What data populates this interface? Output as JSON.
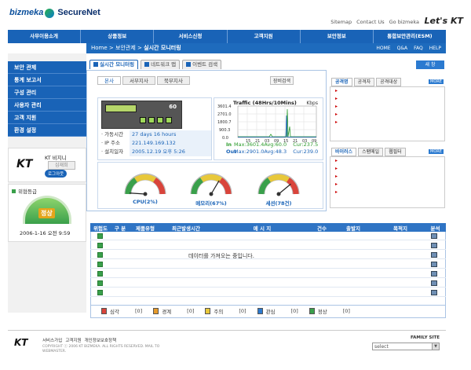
{
  "brand": {
    "name1": "bizmeka",
    "name2": "SecureNet",
    "tagline": "Let's KT"
  },
  "top_links": [
    "Sitemap",
    "Contact Us",
    "Go bizmeka"
  ],
  "gnb": [
    "사무이용소개",
    "상품정보",
    "서비스신청",
    "고객지원",
    "보안정보",
    "통합보안관리(ESM)"
  ],
  "breadcrumb": {
    "home": "Home",
    "sep": ">",
    "section": "보안관제",
    "current": "실시간 모니터링"
  },
  "util_links": [
    "HOME",
    "Q&A",
    "FAQ",
    "HELP"
  ],
  "lnb": [
    "보안 관제",
    "통계 보고서",
    "구성 관리",
    "사용자 관리",
    "고객 지원",
    "환경 설정"
  ],
  "kt_user": {
    "logo": "KT",
    "name": "KT 비지니",
    "sub": "심재희",
    "btn": "로그아웃"
  },
  "risk": {
    "title": "위협등급",
    "level": "정상",
    "datetime": "2006-1-16 오전 9:59"
  },
  "main_tabs": [
    "실시간 모니터링",
    "네트워크 맵",
    "이벤트 검색"
  ],
  "new_btn": "새 창",
  "branch_tabs": [
    "본사",
    "서부지사",
    "북부지사"
  ],
  "equip_search": "장비검색",
  "device": {
    "label": "60",
    "rows": [
      {
        "k": "· 가동시간",
        "v": "27 days 16 hours"
      },
      {
        "k": "· IP 주소",
        "v": "221.149.169.132"
      },
      {
        "k": "· 설치일자",
        "v": "2005.12.19 오후 5:26"
      }
    ]
  },
  "traffic": {
    "title": "Traffic (48Hrs/10Mins)",
    "unit": "Kbps",
    "yticks": [
      "3601.4",
      "2701.0",
      "1800.7",
      "900.3",
      "0.0"
    ],
    "xticks": [
      "15",
      "21",
      "03",
      "09",
      "15",
      "21",
      "03",
      "09"
    ],
    "in": {
      "label": "In",
      "max": "Max:3601.4",
      "avg": "Avg:60.0",
      "cur": "Cur:237.5"
    },
    "out": {
      "label": "Out",
      "max": "Max:2901.0",
      "avg": "Avg:48.3",
      "cur": "Cur:239.0"
    }
  },
  "gauges": [
    {
      "label": "CPU(2%)",
      "value": 2
    },
    {
      "label": "메모리(67%)",
      "value": 67
    },
    {
      "label": "세션(78건)",
      "value": 78
    }
  ],
  "side": {
    "tabs1": [
      "공격명",
      "공격자",
      "공격대상"
    ],
    "tabs2": [
      "바이러스",
      "스팸메일",
      "웹필터"
    ],
    "more": "MORE"
  },
  "grid": {
    "headers": [
      "위험도",
      "구 분",
      "제품유형",
      "최근발생시간",
      "메 시 지",
      "건수",
      "출발지",
      "목적지",
      "분석"
    ],
    "loading": "데이터를 가져오는 중입니다.",
    "rows": 7
  },
  "legend": [
    {
      "label": "심각",
      "count": "[0]",
      "color": "#d9443b"
    },
    {
      "label": "경계",
      "count": "[0]",
      "color": "#e69a2a"
    },
    {
      "label": "주의",
      "count": "[0]",
      "color": "#e8c83a"
    },
    {
      "label": "관심",
      "count": "[0]",
      "color": "#2b7ad0"
    },
    {
      "label": "정상",
      "count": "[0]",
      "color": "#3aa04b"
    }
  ],
  "footer": {
    "logo": "KT",
    "links": [
      "서비스가입",
      "고객지원",
      "개인정보보호정책"
    ],
    "copyright": "COPYRIGHT ⓒ 2006 KT BIZMEKA. ALL RIGHTS RESERVED. MAIL TO WEBMASTER.",
    "family": "FAMILY SITE",
    "select": "select"
  }
}
